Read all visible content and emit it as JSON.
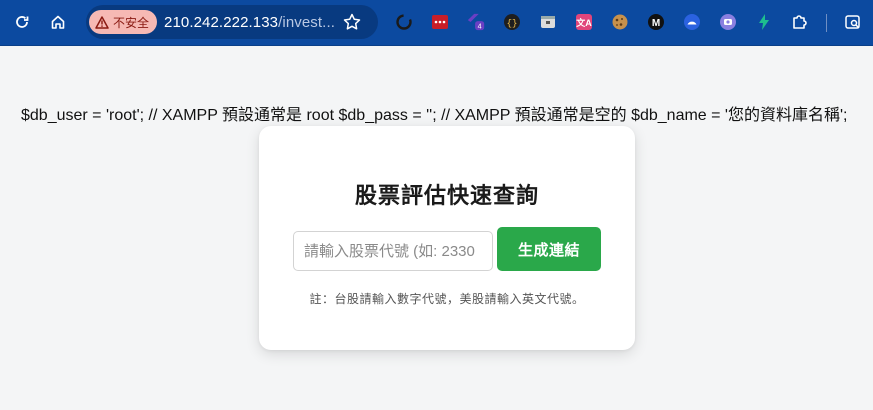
{
  "browser": {
    "security_label": "不安全",
    "url_host": "210.242.222.133",
    "url_path": "/invest...",
    "extensions": [
      {
        "name": "sync-extension-icon",
        "color": "#1a1a1a"
      },
      {
        "name": "dots-extension-icon",
        "color": "#c81e28"
      },
      {
        "name": "tag-extension-icon",
        "color": "#6a3fc4",
        "badge": "4"
      },
      {
        "name": "braces-extension-icon",
        "color": "#1e1e1e"
      },
      {
        "name": "window-extension-icon",
        "color": "#dcdcdc"
      },
      {
        "name": "translate-extension-icon",
        "color": "#e0457b"
      },
      {
        "name": "cookie-extension-icon",
        "color": "#b07a3a"
      },
      {
        "name": "m-extension-icon",
        "color": "#111111"
      },
      {
        "name": "moon-extension-icon",
        "color": "#2b62e0"
      },
      {
        "name": "camera-extension-icon",
        "color": "#8a7fe0"
      },
      {
        "name": "bolt-extension-icon",
        "color": "#1dbf8e"
      }
    ],
    "colors": {
      "toolbar": "#0c4aa0",
      "omnibox": "#083a80",
      "warning_chip": "#f6b9b4"
    }
  },
  "page": {
    "php_output": "$db_user = 'root'; // XAMPP 預設通常是 root $db_pass = ''; // XAMPP 預設通常是空的 $db_name = '您的資料庫名稱';",
    "title": "股票評估快速查詢",
    "input_placeholder": "請輸入股票代號 (如: 2330",
    "input_value": "",
    "button_label": "生成連結",
    "note": "註：台股請輸入數字代號，美股請輸入英文代號。",
    "colors": {
      "button": "#2aa84a",
      "background": "#f4f5f6"
    }
  }
}
